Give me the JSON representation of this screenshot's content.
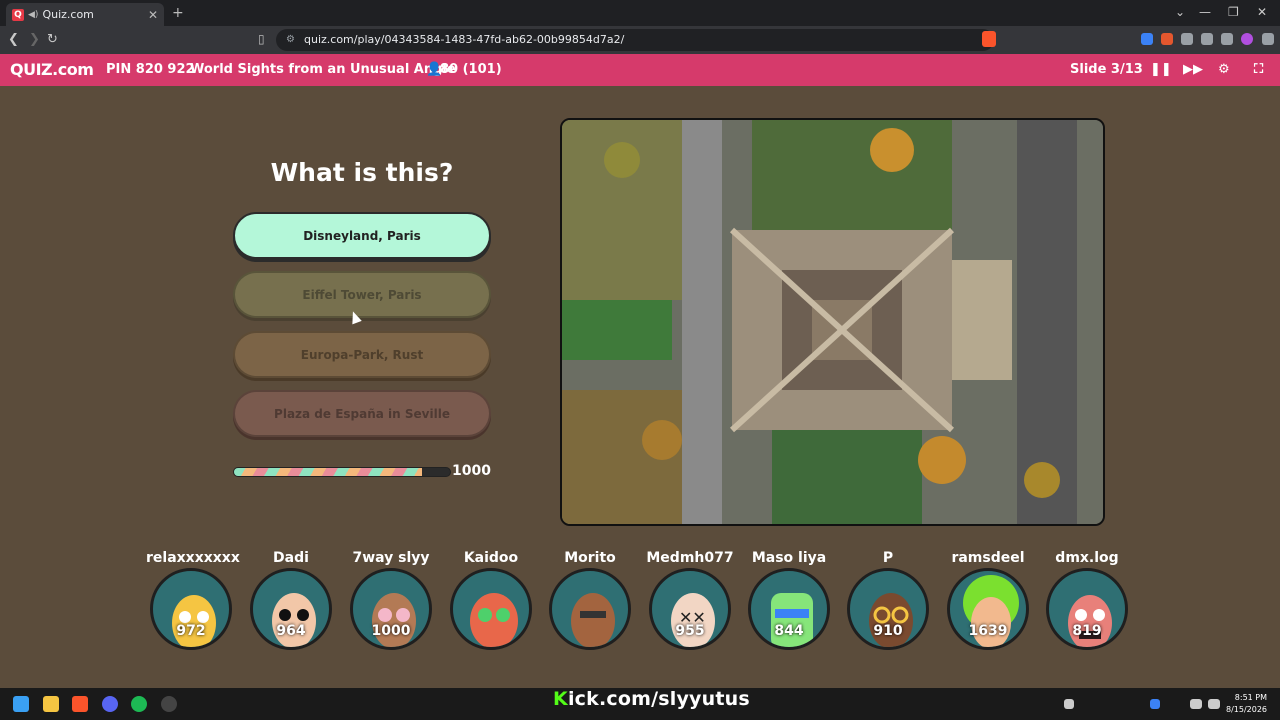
{
  "browser": {
    "tab_title": "Quiz.com",
    "tab_close": "✕",
    "new_tab": "+",
    "url": "quiz.com/play/04343584-1483-47fd-ab62-00b99854d7a2/"
  },
  "quiz_bar": {
    "logo": "QUIZ.com",
    "pin": "PIN 820 922",
    "title": "World Sights from an Unusual Angle",
    "players": "80 (101)",
    "slide": "Slide 3/13"
  },
  "question": {
    "text": "What is this?",
    "answers": [
      {
        "label": "Disneyland, Paris"
      },
      {
        "label": "Eiffel Tower, Paris"
      },
      {
        "label": "Europa-Park, Rust"
      },
      {
        "label": "Plaza de España in Seville"
      }
    ],
    "timer_points": "1000",
    "timer_progress": 0.87
  },
  "players": [
    {
      "name": "relaxxxxxxx",
      "score": "972"
    },
    {
      "name": "Dadi",
      "score": "964"
    },
    {
      "name": "7way slyy",
      "score": "1000"
    },
    {
      "name": "Kaidoo",
      "score": ""
    },
    {
      "name": "Morito",
      "score": ""
    },
    {
      "name": "Medmh077",
      "score": "955"
    },
    {
      "name": "Maso liya",
      "score": "844"
    },
    {
      "name": "P",
      "score": "910"
    },
    {
      "name": "ramsdeel",
      "score": "1639"
    },
    {
      "name": "dmx.log",
      "score": "819"
    }
  ],
  "overlay": {
    "kick_k": "K",
    "kick_rest": "ick.com/slyyutus"
  },
  "taskbar": {
    "time": "8:51 PM",
    "date": "8/15/2026"
  },
  "colors": {
    "accent": "#d63a6b",
    "background": "#5b4c3b",
    "selected": "#b4f7d9"
  }
}
